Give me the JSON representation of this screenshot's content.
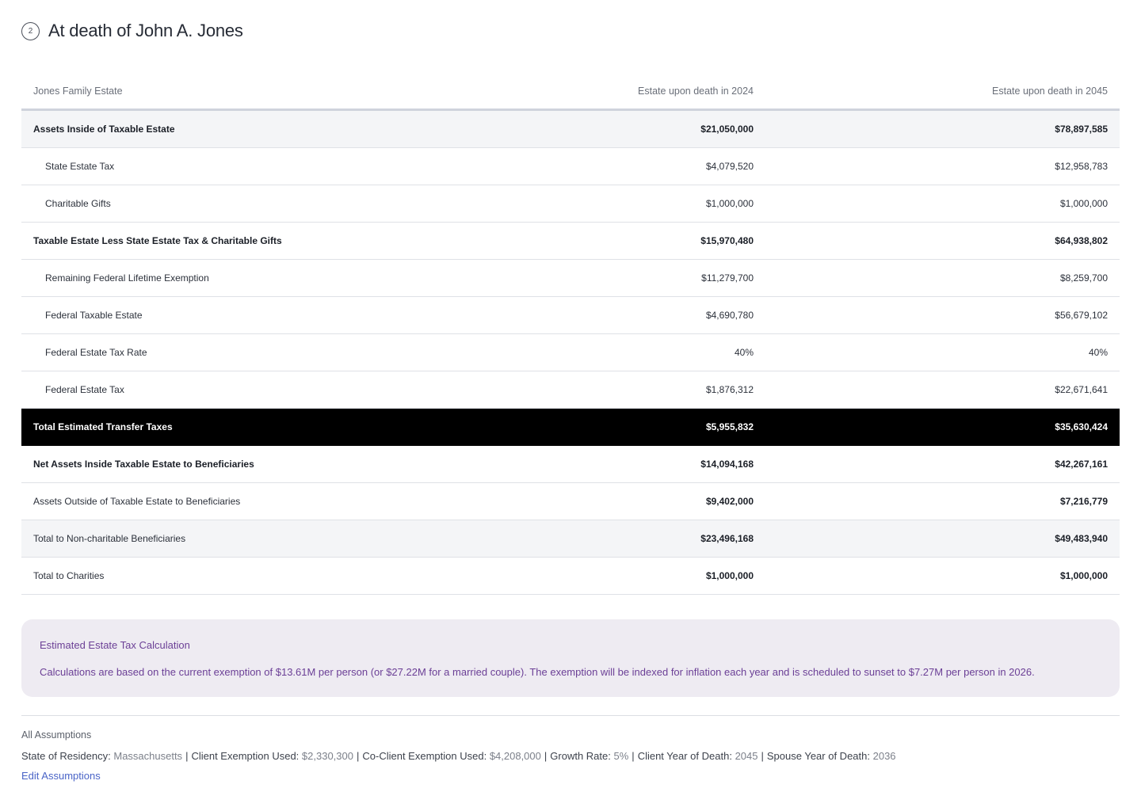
{
  "header": {
    "step_number": "2",
    "title": "At death of John A. Jones"
  },
  "table": {
    "columns": [
      "Jones Family Estate",
      "Estate upon death in 2024",
      "Estate upon death in 2045"
    ],
    "rows": [
      {
        "label": "Assets Inside of Taxable Estate",
        "v2024": "$21,050,000",
        "v2045": "$78,897,585"
      },
      {
        "label": "State Estate Tax",
        "v2024": "$4,079,520",
        "v2045": "$12,958,783"
      },
      {
        "label": "Charitable Gifts",
        "v2024": "$1,000,000",
        "v2045": "$1,000,000"
      },
      {
        "label": "Taxable Estate Less State Estate Tax & Charitable Gifts",
        "v2024": "$15,970,480",
        "v2045": "$64,938,802"
      },
      {
        "label": "Remaining Federal Lifetime Exemption",
        "v2024": "$11,279,700",
        "v2045": "$8,259,700"
      },
      {
        "label": "Federal Taxable Estate",
        "v2024": "$4,690,780",
        "v2045": "$56,679,102"
      },
      {
        "label": "Federal Estate Tax Rate",
        "v2024": "40%",
        "v2045": "40%"
      },
      {
        "label": "Federal Estate Tax",
        "v2024": "$1,876,312",
        "v2045": "$22,671,641"
      },
      {
        "label": "Total Estimated Transfer Taxes",
        "v2024": "$5,955,832",
        "v2045": "$35,630,424"
      },
      {
        "label": "Net Assets Inside Taxable Estate to Beneficiaries",
        "v2024": "$14,094,168",
        "v2045": "$42,267,161"
      },
      {
        "label": "Assets Outside of Taxable Estate to Beneficiaries",
        "v2024": "$9,402,000",
        "v2045": "$7,216,779"
      },
      {
        "label": "Total to Non-charitable Beneficiaries",
        "v2024": "$23,496,168",
        "v2045": "$49,483,940"
      },
      {
        "label": "Total to Charities",
        "v2024": "$1,000,000",
        "v2045": "$1,000,000"
      }
    ],
    "highlight_color": "#000000"
  },
  "callout": {
    "title": "Estimated Estate Tax Calculation",
    "text": "Calculations are based on the current exemption of $13.61M per person (or $27.22M for a married couple). The exemption will be indexed for inflation each year and is scheduled to sunset to $7.27M per person in 2026.",
    "text_color": "#6b3f96",
    "background": "#eeebf2"
  },
  "assumptions": {
    "title": "All Assumptions",
    "items": [
      {
        "label": "State of Residency:",
        "value": "Massachusetts"
      },
      {
        "label": "Client Exemption Used:",
        "value": "$2,330,300"
      },
      {
        "label": "Co-Client Exemption Used:",
        "value": "$4,208,000"
      },
      {
        "label": "Growth Rate:",
        "value": "5%"
      },
      {
        "label": "Client Year of Death:",
        "value": "2045"
      },
      {
        "label": "Spouse Year of Death:",
        "value": "2036"
      }
    ],
    "separator": "|",
    "edit_label": "Edit Assumptions",
    "link_color": "#4a64c7"
  }
}
